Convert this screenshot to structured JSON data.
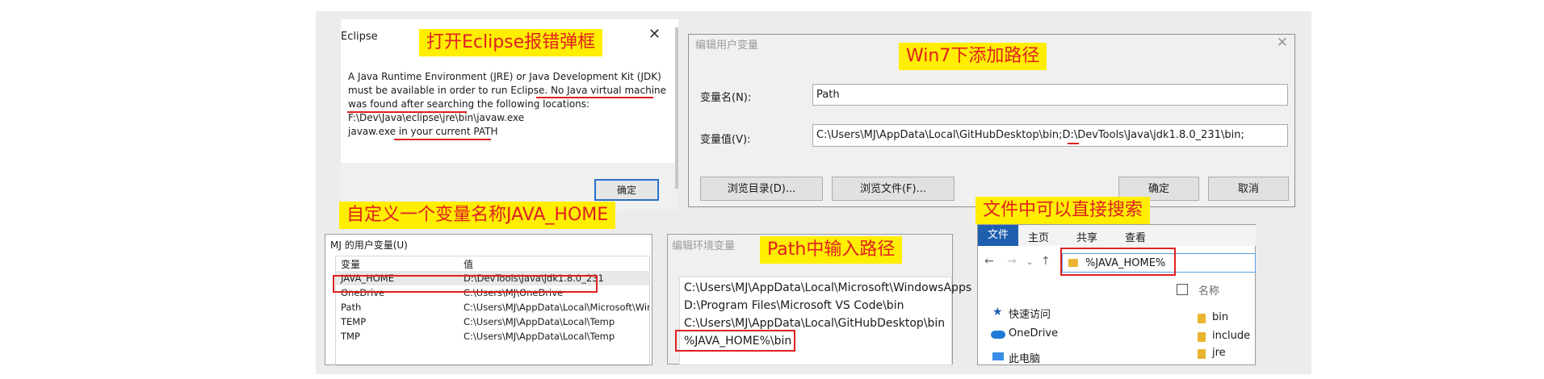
{
  "captions": {
    "eclipse_error": "打开Eclipse报错弹框",
    "win7_add_path": "Win7下添加路径",
    "custom_var": "自定义一个变量名称JAVA_HOME",
    "path_input": "Path中输入路径",
    "search": "文件中可以直接搜索"
  },
  "eclipse_dialog": {
    "title": "Eclipse",
    "close": "✕",
    "message_lines": [
      "A Java Runtime Environment (JRE) or Java Development Kit (JDK)",
      "must be available in order to run Eclipse. No Java virtual machine",
      "was found after searching the following locations:",
      "F:\\Dev\\Java\\eclipse\\jre\\bin\\javaw.exe",
      "javaw.exe in your current PATH"
    ],
    "ok_button": "确定"
  },
  "edit_user_var_dialog": {
    "title": "编辑用户变量",
    "close": "✕",
    "name_label": "变量名(N):",
    "name_value": "Path",
    "value_label": "变量值(V):",
    "value_value": "C:\\Users\\MJ\\AppData\\Local\\GitHubDesktop\\bin;D:\\DevTools\\Java\\jdk1.8.0_231\\bin;",
    "browse_dir_button": "浏览目录(D)...",
    "browse_file_button": "浏览文件(F)...",
    "ok_button": "确定",
    "cancel_button": "取消"
  },
  "user_vars": {
    "title": "MJ 的用户变量(U)",
    "col_var": "变量",
    "col_value": "值",
    "rows": [
      {
        "name": "JAVA_HOME",
        "value": "D:\\DevTools\\Java\\jdk1.8.0_231"
      },
      {
        "name": "OneDrive",
        "value": "C:\\Users\\MJ\\OneDrive"
      },
      {
        "name": "Path",
        "value": "C:\\Users\\MJ\\AppData\\Local\\Microsoft\\Window"
      },
      {
        "name": "TEMP",
        "value": "C:\\Users\\MJ\\AppData\\Local\\Temp"
      },
      {
        "name": "TMP",
        "value": "C:\\Users\\MJ\\AppData\\Local\\Temp"
      }
    ]
  },
  "edit_env_var": {
    "title": "编辑环境变量",
    "items": [
      "C:\\Users\\MJ\\AppData\\Local\\Microsoft\\WindowsApps",
      "D:\\Program Files\\Microsoft VS Code\\bin",
      "C:\\Users\\MJ\\AppData\\Local\\GitHubDesktop\\bin",
      "%JAVA_HOME%\\bin"
    ]
  },
  "explorer": {
    "tabs": [
      "文件",
      "主页",
      "共享",
      "查看"
    ],
    "address": "%JAVA_HOME%",
    "column_name": "名称",
    "nav_items": [
      "快速访问",
      "OneDrive",
      "此电脑"
    ],
    "files": [
      "bin",
      "include",
      "jre"
    ]
  }
}
